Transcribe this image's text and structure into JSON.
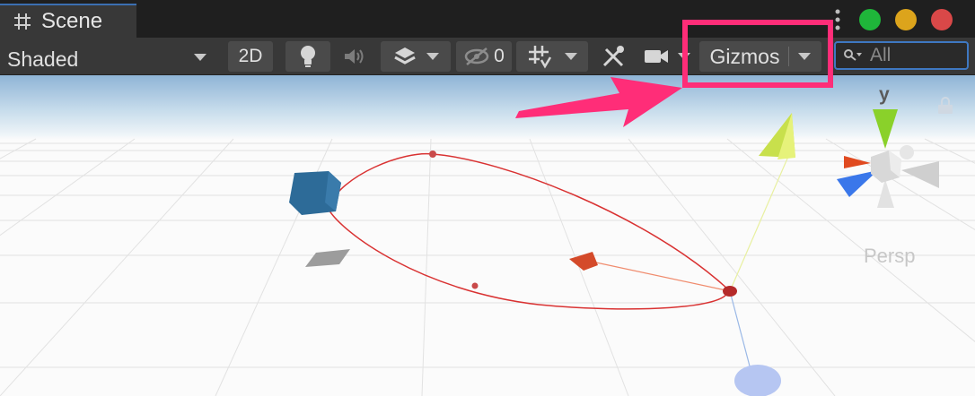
{
  "tab": {
    "label": "Scene",
    "icon": "hash-icon"
  },
  "window_buttons": {
    "green": "#1fb63a",
    "yellow": "#dca41c",
    "red": "#d94848"
  },
  "toolbar": {
    "shading_mode": "Shaded",
    "mode_2d": "2D",
    "lighting_icon": "light-bulb-icon",
    "audio_icon": "speaker-icon",
    "effects_icon": "layers-icon",
    "hidden_count": "0",
    "grid_icon": "grid-snap-icon",
    "tools_icon": "tools-icon",
    "camera_icon": "camera-icon",
    "gizmos_label": "Gizmos",
    "search_placeholder": "All"
  },
  "viewport": {
    "projection_label": "Persp",
    "axis_label": "y"
  },
  "annotation": {
    "color": "#ff2d78"
  },
  "colors": {
    "accent": "#3e78c2",
    "toolbar_bg": "#383838",
    "tab_bg": "#383838"
  }
}
